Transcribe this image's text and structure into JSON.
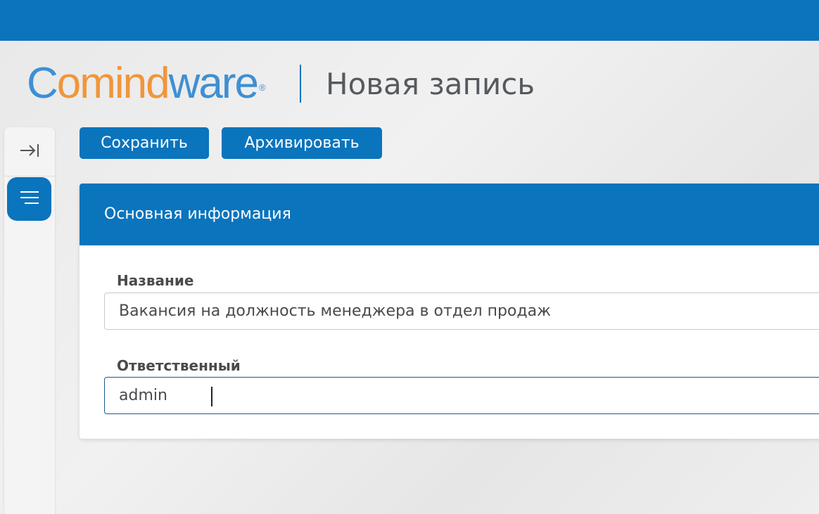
{
  "header": {
    "logo": {
      "part1": "C",
      "part2": "o",
      "part3": "mind",
      "part4": "ware",
      "registered": "®"
    },
    "page_title": "Новая запись"
  },
  "toolbar": {
    "save_label": "Сохранить",
    "archive_label": "Архивировать"
  },
  "sidebar": {
    "collapse_icon": "arrow-right-to-bar-icon",
    "menu_icon": "hamburger-menu-icon"
  },
  "form": {
    "section_title": "Основная информация",
    "fields": [
      {
        "label": "Название",
        "value": "Вакансия на должность менеджера в отдел продаж"
      },
      {
        "label": "Ответственный",
        "value": "admin"
      }
    ]
  },
  "colors": {
    "brand_blue": "#0a74bd",
    "logo_blue": "#3f8fd3",
    "logo_orange": "#f0963a"
  }
}
